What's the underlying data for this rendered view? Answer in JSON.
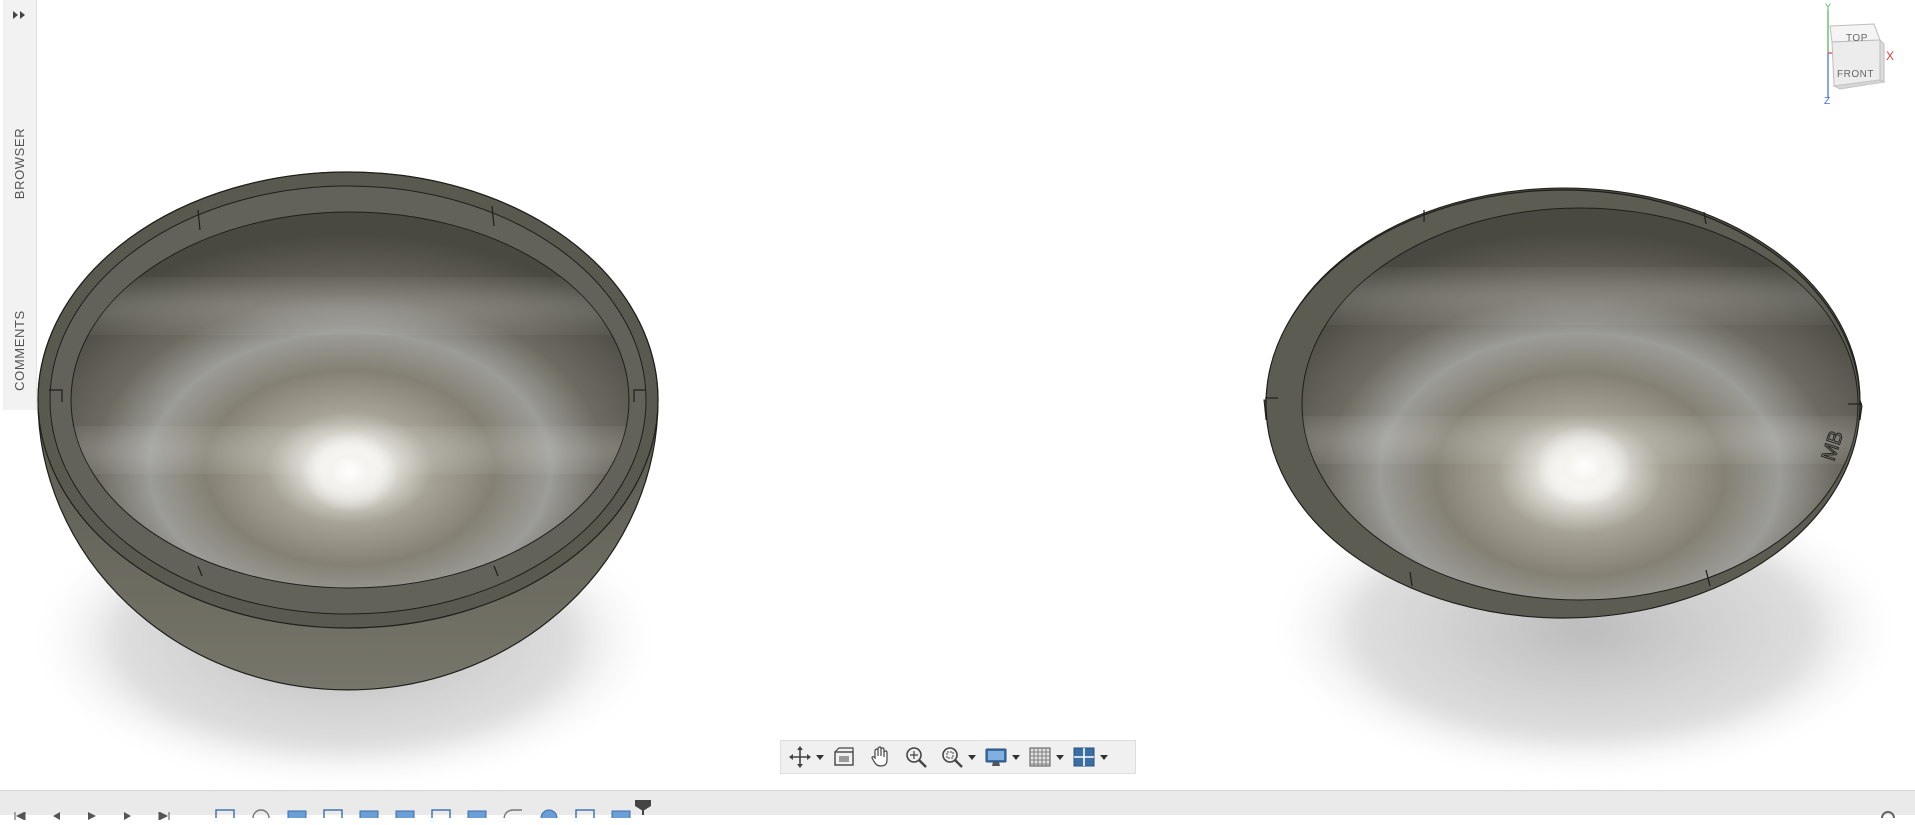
{
  "side_panel": {
    "browser_label": "BROWSER",
    "comments_label": "COMMENTS"
  },
  "viewcube": {
    "top_label": "TOP",
    "front_label": "FRONT",
    "axis_y": "Y",
    "axis_x": "X",
    "axis_z": "Z"
  },
  "model": {
    "engraving": "MB"
  },
  "colors": {
    "viewport_bg": "#ffffff",
    "panel_bg": "#f2f2f2",
    "toolbar_bg": "#f0f0f0",
    "icon_blue": "#3a6ea5",
    "model_base": "#5c5a4f",
    "axis_x": "#e04040",
    "axis_y": "#4caf50",
    "axis_z": "#3a6ee0"
  },
  "nav_toolbar": {
    "tools": [
      "orbit-icon",
      "look-at-icon",
      "pan-icon",
      "zoom-icon",
      "fit-icon",
      "display-settings-icon",
      "grid-snaps-icon",
      "viewports-icon"
    ]
  },
  "timeline": {
    "features": [
      "sketch",
      "revolve",
      "extrude",
      "sketch",
      "extrude",
      "extrude",
      "sketch",
      "extrude",
      "fillet",
      "split",
      "sketch",
      "extrude",
      "move"
    ]
  }
}
